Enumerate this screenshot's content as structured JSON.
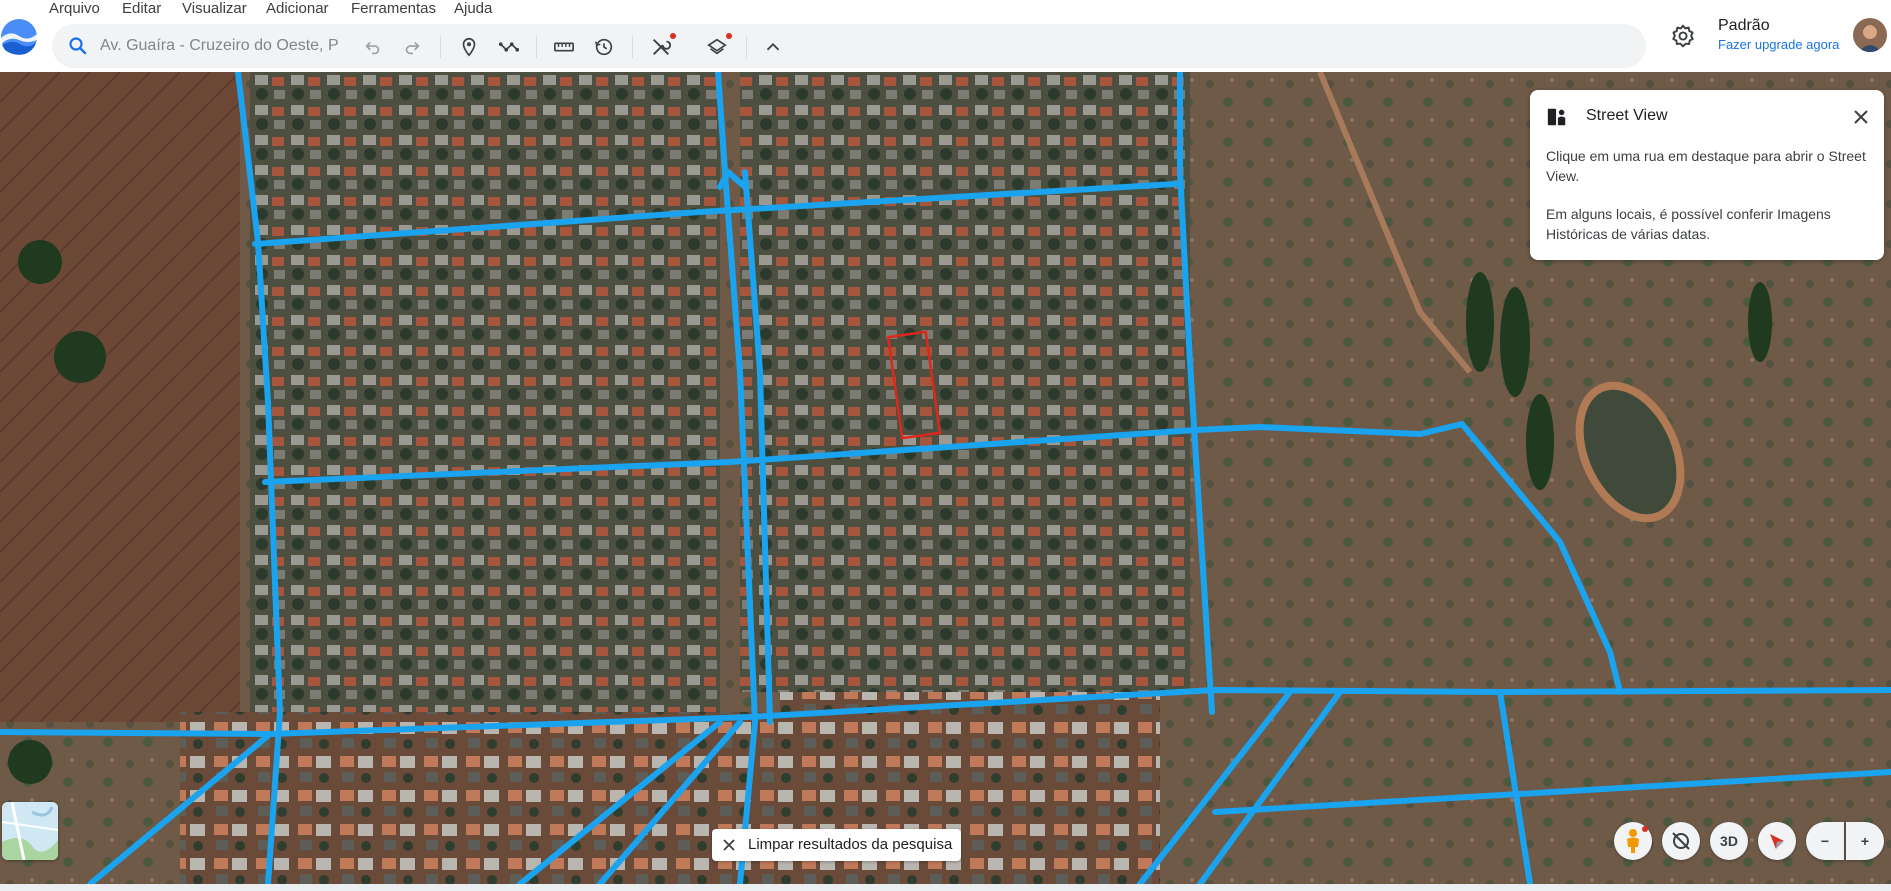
{
  "menu": {
    "items": [
      {
        "label": "Arquivo"
      },
      {
        "label": "Editar"
      },
      {
        "label": "Visualizar"
      },
      {
        "label": "Adicionar"
      },
      {
        "label": "Ferramentas"
      },
      {
        "label": "Ajuda"
      }
    ]
  },
  "search": {
    "placeholder": "Av. Guaíra - Cruzeiro do Oeste, P"
  },
  "toolbar": {
    "icons": [
      "undo-icon",
      "redo-icon",
      "placemark-icon",
      "path-icon",
      "ruler-icon",
      "historical-imagery-icon",
      "tools-icon",
      "layers-icon",
      "collapse-icon"
    ]
  },
  "profile": {
    "name": "Padrão",
    "upgrade_label": "Fazer upgrade agora"
  },
  "street_view": {
    "title": "Street View",
    "paragraph1": "Clique em uma rua em destaque para abrir o Street View.",
    "paragraph2": "Em alguns locais, é possível conferir Imagens Históricas de várias datas."
  },
  "clear_search": {
    "label": "Limpar resultados da pesquisa"
  },
  "map_controls": {
    "three_d_label": "3D",
    "zoom_out_label": "−",
    "zoom_in_label": "+"
  },
  "colors": {
    "road_highlight": "#1aa3ef",
    "selection_outline": "#e0261b",
    "accent": "#1a73e8",
    "notification_dot": "#d93025"
  }
}
